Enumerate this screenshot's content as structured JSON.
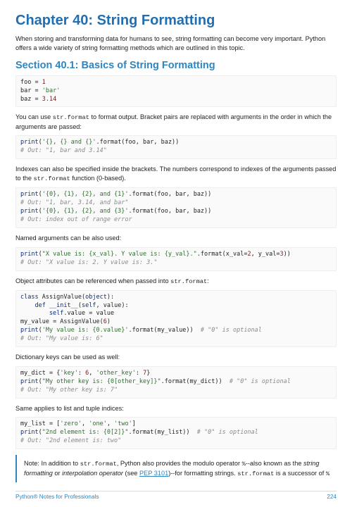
{
  "chapter_title": "Chapter 40: String Formatting",
  "intro": "When storing and transforming data for humans to see, string formatting can become very important. Python offers a wide variety of string formatting methods which are outlined in this topic.",
  "section_title": "Section 40.1: Basics of String Formatting",
  "p1a": "You can use ",
  "p1_code": "str.format",
  "p1b": " to format output. Bracket pairs are replaced with arguments in the order in which the arguments are passed:",
  "p2a": "Indexes can also be specified inside the brackets. The numbers correspond to indexes of the arguments passed to the ",
  "p2_code": "str.format",
  "p2b": " function (0-based).",
  "p3": "Named arguments can be also used:",
  "p4a": "Object attributes can be referenced when passed into ",
  "p4_code": "str.format",
  "p4b": ":",
  "p5": "Dictionary keys can be used as well:",
  "p6": "Same applies to list and tuple indices:",
  "note_a": "Note: In addition to ",
  "note_code1": "str.format",
  "note_b": ", Python also provides the modulo operator ",
  "note_code2": "%",
  "note_c": "--also known as the ",
  "note_em1": "string formatting",
  "note_d": " or ",
  "note_em2": "interpolation operator",
  "note_e": " (see ",
  "note_link": "PEP 3101",
  "note_f": ")--for formatting strings. ",
  "note_code3": "str.format",
  "note_g": " is a successor of ",
  "note_code4": "%",
  "footer_left": "Python® Notes for Professionals",
  "footer_right": "224",
  "code": {
    "b1": {
      "l1a": "foo ",
      "l1b": "=",
      "l1c": " 1",
      "l2a": "bar ",
      "l2b": "=",
      "l2c": " 'bar'",
      "l3a": "baz ",
      "l3b": "=",
      "l3c": " 3.14"
    },
    "b2": {
      "print": "print",
      "open": "(",
      "str": "'{}, {} and {}'",
      "dot": ".format(foo",
      "c1": ",",
      "sp1": " bar",
      "c2": ",",
      "sp2": " baz))",
      "cmt": "# Out: \"1, bar and 3.14\""
    },
    "b3": {
      "p1": "print",
      "o1": "(",
      "s1": "'{0}, {1}, {2}, and {1}'",
      "d1": ".format(foo",
      "c11": ",",
      "sp11": " bar",
      "c12": ",",
      "sp12": " baz))",
      "cmt1": "# Out: \"1, bar, 3.14, and bar\"",
      "p2": "print",
      "o2": "(",
      "s2": "'{0}, {1}, {2}, and {3}'",
      "d2": ".format(foo",
      "c21": ",",
      "sp21": " bar",
      "c22": ",",
      "sp22": " baz))",
      "cmt2": "# Out: index out of range error"
    },
    "b4": {
      "p": "print",
      "o": "(",
      "s": "\"X value is: {x_val}. Y value is: {y_val}.\"",
      "d": ".format(x_val",
      "eq1": "=",
      "n1": "2",
      "c": ",",
      "sp": " y_val",
      "eq2": "=",
      "n2": "3",
      "close": "))",
      "cmt": "# Out: \"X value is: 2. Y value is: 3.\""
    },
    "b5": {
      "cls": "class",
      "clsname": " AssignValue(",
      "obj": "object",
      "cp": "):",
      "defkw": "    def",
      "init": " __init__",
      "args": "(",
      "self1": "self",
      "argsp": ",",
      "argrest": " value):",
      "body1": "        self",
      "body2": ".value ",
      "body3": "=",
      "body4": " value",
      "mv": "my_value ",
      "mveq": "=",
      "mvv": " AssignValue(",
      "mvn": "6",
      "mvc": ")",
      "p": "print",
      "po": "(",
      "ps": "'My value is: {0.value}'",
      "pd": ".format(my_value))  ",
      "pcmt": "# \"0\" is optional",
      "cmt": "# Out: \"My value is: 6\""
    },
    "b6": {
      "md": "my_dict ",
      "eq": "=",
      "cb": " {",
      "k1": "'key'",
      "col1": ": ",
      "v1": "6",
      "com": ",",
      "sp": " ",
      "k2": "'other_key'",
      "col2": ": ",
      "v2": "7",
      "ce": "}",
      "p": "print",
      "po": "(",
      "ps": "\"My other key is: {0[other_key]}\"",
      "pd": ".format(my_dict))  ",
      "pcmt": "# \"0\" is optional",
      "cmt": "# Out: \"My other key is: 7\""
    },
    "b7": {
      "ml": "my_list ",
      "eq": "=",
      "ob": " [",
      "e1": "'zero'",
      "c1": ",",
      "sp1": " ",
      "e2": "'one'",
      "c2": ",",
      "sp2": " ",
      "e3": "'two'",
      "cb": "]",
      "p": "print",
      "po": "(",
      "ps": "\"2nd element is: {0[2]}\"",
      "pd": ".format(my_list))  ",
      "pcmt": "# \"0\" is optional",
      "cmt": "# Out: \"2nd element is: two\""
    }
  }
}
